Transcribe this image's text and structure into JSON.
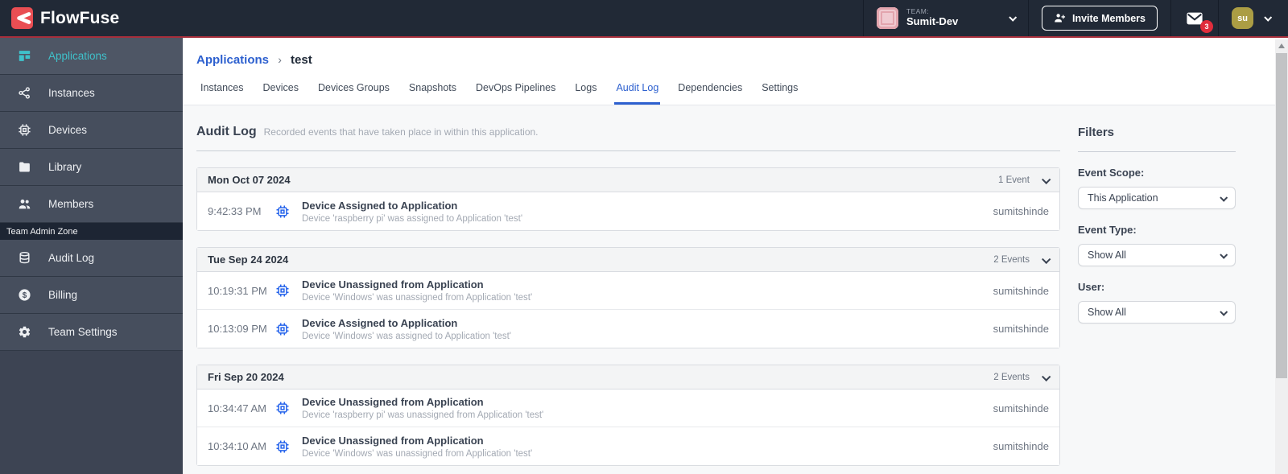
{
  "header": {
    "logo_text": "FlowFuse",
    "team_label": "TEAM:",
    "team_name": "Sumit-Dev",
    "invite_button_label": "Invite Members",
    "notification_count": "3",
    "user_avatar_initials": "su"
  },
  "sidebar": {
    "items": [
      {
        "label": "Applications",
        "icon": "applications-icon"
      },
      {
        "label": "Instances",
        "icon": "instances-icon"
      },
      {
        "label": "Devices",
        "icon": "devices-icon"
      },
      {
        "label": "Library",
        "icon": "library-icon"
      },
      {
        "label": "Members",
        "icon": "members-icon"
      }
    ],
    "active_item": "Applications",
    "admin_section_label": "Team Admin Zone",
    "admin_items": [
      {
        "label": "Audit Log",
        "icon": "audit-log-icon"
      },
      {
        "label": "Billing",
        "icon": "billing-icon"
      },
      {
        "label": "Team Settings",
        "icon": "team-settings-icon"
      }
    ]
  },
  "breadcrumb": {
    "parent": "Applications",
    "separator": "›",
    "current": "test"
  },
  "tabs": {
    "items": [
      "Instances",
      "Devices",
      "Devices Groups",
      "Snapshots",
      "DevOps Pipelines",
      "Logs",
      "Audit Log",
      "Dependencies",
      "Settings"
    ],
    "active": "Audit Log"
  },
  "audit_log": {
    "title": "Audit Log",
    "description": "Recorded events that have taken place in within this application.",
    "groups": [
      {
        "date": "Mon Oct 07 2024",
        "count_label": "1 Event",
        "events": [
          {
            "time": "9:42:33 PM",
            "title": "Device Assigned to Application",
            "description": "Device 'raspberry pi' was assigned to Application 'test'",
            "user": "sumitshinde"
          }
        ]
      },
      {
        "date": "Tue Sep 24 2024",
        "count_label": "2 Events",
        "events": [
          {
            "time": "10:19:31 PM",
            "title": "Device Unassigned from Application",
            "description": "Device 'Windows' was unassigned from Application 'test'",
            "user": "sumitshinde"
          },
          {
            "time": "10:13:09 PM",
            "title": "Device Assigned to Application",
            "description": "Device 'Windows' was assigned to Application 'test'",
            "user": "sumitshinde"
          }
        ]
      },
      {
        "date": "Fri Sep 20 2024",
        "count_label": "2 Events",
        "events": [
          {
            "time": "10:34:47 AM",
            "title": "Device Unassigned from Application",
            "description": "Device 'raspberry pi' was unassigned from Application 'test'",
            "user": "sumitshinde"
          },
          {
            "time": "10:34:10 AM",
            "title": "Device Unassigned from Application",
            "description": "Device 'Windows' was unassigned from Application 'test'",
            "user": "sumitshinde"
          }
        ]
      }
    ]
  },
  "filters": {
    "title": "Filters",
    "event_scope": {
      "label": "Event Scope:",
      "value": "This Application"
    },
    "event_type": {
      "label": "Event Type:",
      "value": "Show All"
    },
    "user": {
      "label": "User:",
      "value": "Show All"
    }
  },
  "colors": {
    "header_bg": "#212936",
    "accent_red_line": "#A72F3C",
    "brand_red": "#E94E53",
    "sidebar_active_teal": "#3FC1CA",
    "link_blue": "#2D60CF",
    "event_chip_blue": "#2563EB",
    "notification_badge_red": "#E02D3C",
    "user_avatar_olive": "#AB9D44"
  }
}
